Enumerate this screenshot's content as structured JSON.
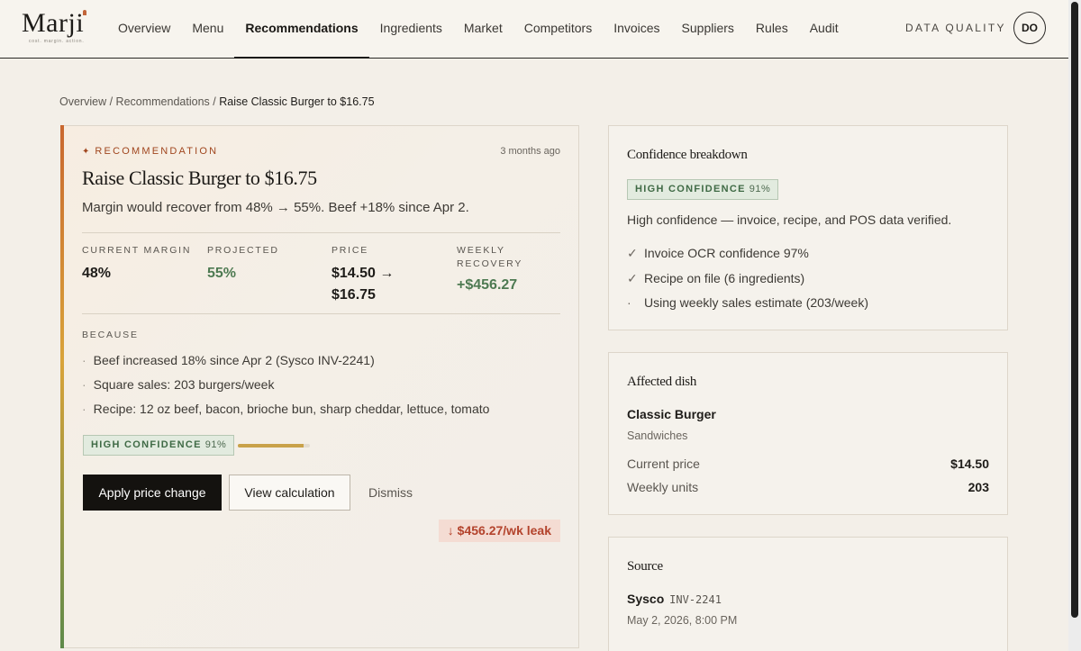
{
  "brand": {
    "name": "Marji",
    "tagline": "cost. margin. action."
  },
  "nav": {
    "items": [
      "Overview",
      "Menu",
      "Recommendations",
      "Ingredients",
      "Market",
      "Competitors",
      "Invoices",
      "Suppliers",
      "Rules",
      "Audit"
    ],
    "active": "Recommendations",
    "data_quality_label": "DATA QUALITY",
    "avatar_initials": "DO"
  },
  "breadcrumb": {
    "items": [
      "Overview",
      "Recommendations"
    ],
    "current": "Raise Classic Burger to $16.75",
    "separator": "/"
  },
  "recommendation": {
    "kicker": "RECOMMENDATION",
    "age": "3 months ago",
    "title": "Raise Classic Burger to $16.75",
    "subtitle": "Margin would recover from 48% → 55%. Beef +18% since Apr 2.",
    "metrics": [
      {
        "label": "CURRENT MARGIN",
        "value": "48%"
      },
      {
        "label": "PROJECTED",
        "value": "55%"
      },
      {
        "label": "PRICE",
        "value": "$14.50 → $16.75"
      },
      {
        "label": "WEEKLY RECOVERY",
        "value": "+$456.27"
      }
    ],
    "because_label": "BECAUSE",
    "because": [
      "Beef increased 18% since Apr 2 (Sysco INV-2241)",
      "Square sales: 203 burgers/week",
      "Recipe: 12 oz beef, bacon, brioche bun, sharp cheddar, lettuce, tomato"
    ],
    "confidence": {
      "label": "HIGH CONFIDENCE",
      "pct": "91%",
      "value": 0.91
    },
    "actions": {
      "apply": "Apply price change",
      "view": "View calculation",
      "dismiss": "Dismiss"
    },
    "leak": "↓ $456.27/wk leak"
  },
  "confidence_breakdown": {
    "title": "Confidence breakdown",
    "badge_label": "HIGH CONFIDENCE",
    "badge_pct": "91%",
    "summary": "High confidence — invoice, recipe, and POS data verified.",
    "items": [
      {
        "mark": "✓",
        "text": "Invoice OCR confidence 97%"
      },
      {
        "mark": "✓",
        "text": "Recipe on file (6 ingredients)"
      },
      {
        "mark": "·",
        "text": "Using weekly sales estimate (203/week)"
      }
    ]
  },
  "affected_dish": {
    "title": "Affected dish",
    "name": "Classic Burger",
    "category": "Sandwiches",
    "current_price_label": "Current price",
    "current_price": "$14.50",
    "weekly_units_label": "Weekly units",
    "weekly_units": "203"
  },
  "source": {
    "title": "Source",
    "vendor": "Sysco",
    "invoice": "INV-2241",
    "date": "May 2, 2026, 8:00 PM"
  },
  "colors": {
    "accent": "#c9672f",
    "green": "#4e7a52",
    "leak": "#b3432c",
    "background": "#f3efe8"
  }
}
